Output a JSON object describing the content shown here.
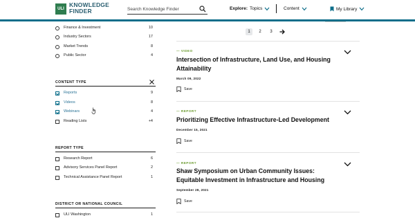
{
  "header": {
    "logo_badge": "ULI",
    "logo_line1": "KNOWLEDGE",
    "logo_line2": "FINDER",
    "search_placeholder": "Search Knowledge Finder",
    "explore_label": "Explore:",
    "topics_label": "Topics",
    "content_label": "Content",
    "my_library_label": "My Library",
    "accent_color": "#0d6e8a"
  },
  "sidebar": {
    "topic_items": [
      {
        "label": "Finance & Investment",
        "count": "10"
      },
      {
        "label": "Industry Sectors",
        "count": "17"
      },
      {
        "label": "Market Trends",
        "count": "8"
      },
      {
        "label": "Public Sector",
        "count": "4"
      }
    ],
    "content_type": {
      "title": "CONTENT TYPE",
      "items": [
        {
          "label": "Reports",
          "count": "9",
          "checked": true
        },
        {
          "label": "Videos",
          "count": "8",
          "checked": true
        },
        {
          "label": "Webinars",
          "count": "4",
          "checked": true
        },
        {
          "label": "Reading Lists",
          "count": "+4",
          "checked": false
        }
      ]
    },
    "report_type": {
      "title": "REPORT TYPE",
      "items": [
        {
          "label": "Research Report",
          "count": "6"
        },
        {
          "label": "Advisory Services Panel Report",
          "count": "2"
        },
        {
          "label": "Technical Assistance Panel Report",
          "count": "1"
        }
      ]
    },
    "district": {
      "title": "DISTRICT OR NATIONAL COUNCIL",
      "items": [
        {
          "label": "ULI Washington",
          "count": "1"
        }
      ]
    }
  },
  "pagination": {
    "pages": [
      "1",
      "2",
      "3"
    ],
    "current": "1"
  },
  "results": [
    {
      "tag": "— VIDEO",
      "title": "Intersection of Infrastructure, Land Use, and Housing Attainability",
      "date": "March 09, 2022",
      "save_label": "Save"
    },
    {
      "tag": "— REPORT",
      "title": "Prioritizing Effective Infrastructure-Led Development",
      "date": "December 15, 2021",
      "save_label": "Save"
    },
    {
      "tag": "— REPORT",
      "title": "Shaw Symposium on Urban Community Issues: Equitable Investment in Infrastructure and Housing",
      "date": "September 28, 2021",
      "save_label": "Save"
    }
  ]
}
